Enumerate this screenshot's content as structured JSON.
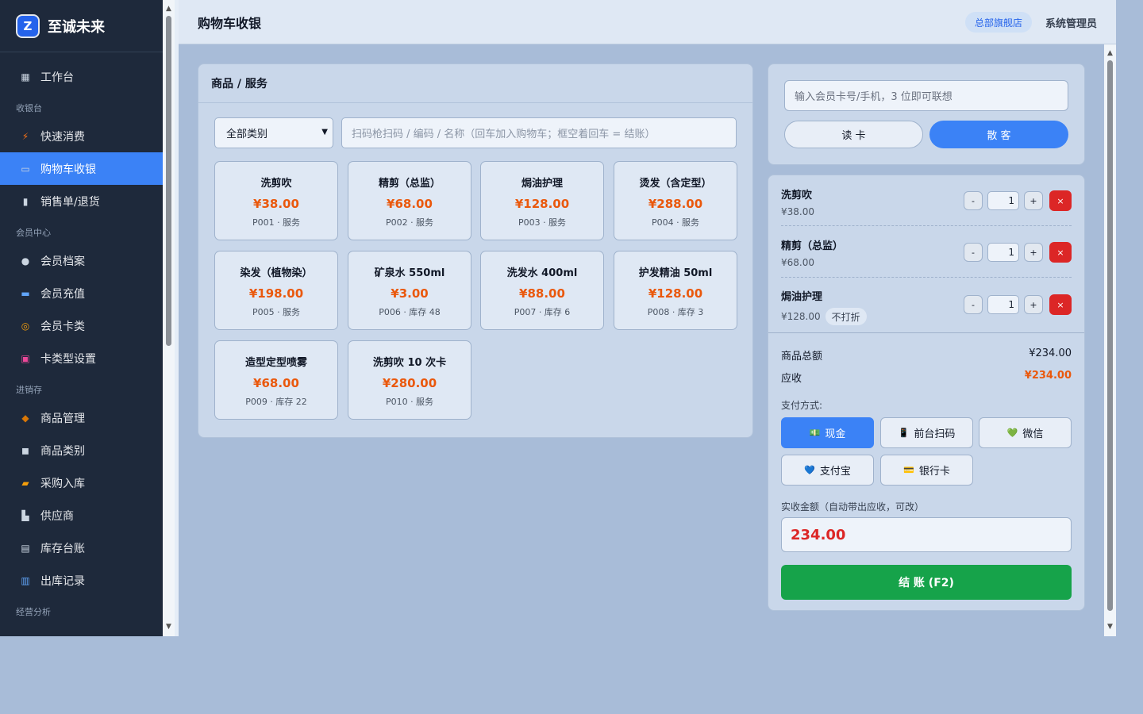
{
  "brand": {
    "logo_text": "Z",
    "name": "至诚未来"
  },
  "sidebar": {
    "items": [
      {
        "icon": "▦",
        "label": "工作台"
      },
      {
        "group": "收银台"
      },
      {
        "icon": "⚡",
        "label": "快速消费"
      },
      {
        "icon": "▭",
        "label": "购物车收银",
        "active": true
      },
      {
        "icon": "▮",
        "label": "销售单/退货"
      },
      {
        "group": "会员中心"
      },
      {
        "icon": "●",
        "label": "会员档案"
      },
      {
        "icon": "▬",
        "label": "会员充值"
      },
      {
        "icon": "◎",
        "label": "会员卡类"
      },
      {
        "icon": "▣",
        "label": "卡类型设置"
      },
      {
        "group": "进销存"
      },
      {
        "icon": "◆",
        "label": "商品管理"
      },
      {
        "icon": "◼",
        "label": "商品类别"
      },
      {
        "icon": "▰",
        "label": "采购入库"
      },
      {
        "icon": "▙",
        "label": "供应商"
      },
      {
        "icon": "▤",
        "label": "库存台账"
      },
      {
        "icon": "▥",
        "label": "出库记录"
      },
      {
        "group": "经营分析"
      }
    ]
  },
  "header": {
    "title": "购物车收银",
    "store": "总部旗舰店",
    "user": "系统管理员"
  },
  "products": {
    "title": "商品 / 服务",
    "category_selected": "全部类别",
    "search_placeholder": "扫码枪扫码 / 编码 / 名称（回车加入购物车；框空着回车 = 结账）",
    "items": [
      {
        "name": "洗剪吹",
        "price": "¥38.00",
        "meta": "P001 · 服务"
      },
      {
        "name": "精剪（总监）",
        "price": "¥68.00",
        "meta": "P002 · 服务"
      },
      {
        "name": "焗油护理",
        "price": "¥128.00",
        "meta": "P003 · 服务"
      },
      {
        "name": "烫发（含定型）",
        "price": "¥288.00",
        "meta": "P004 · 服务"
      },
      {
        "name": "染发（植物染）",
        "price": "¥198.00",
        "meta": "P005 · 服务"
      },
      {
        "name": "矿泉水 550ml",
        "price": "¥3.00",
        "meta": "P006 · 库存 48"
      },
      {
        "name": "洗发水 400ml",
        "price": "¥88.00",
        "meta": "P007 · 库存 6"
      },
      {
        "name": "护发精油 50ml",
        "price": "¥128.00",
        "meta": "P008 · 库存 3"
      },
      {
        "name": "造型定型喷雾",
        "price": "¥68.00",
        "meta": "P009 · 库存 22"
      },
      {
        "name": "洗剪吹 10 次卡",
        "price": "¥280.00",
        "meta": "P010 · 服务"
      }
    ]
  },
  "member": {
    "placeholder": "输入会员卡号/手机，3 位即可联想",
    "read_card": "读 卡",
    "walk_in": "散 客"
  },
  "cart": {
    "items": [
      {
        "name": "洗剪吹",
        "price": "¥38.00",
        "qty": "1",
        "tag": ""
      },
      {
        "name": "精剪（总监）",
        "price": "¥68.00",
        "qty": "1",
        "tag": ""
      },
      {
        "name": "焗油护理",
        "price": "¥128.00",
        "qty": "1",
        "tag": "不打折"
      }
    ],
    "minus": "-",
    "plus": "+",
    "remove": "×",
    "subtotal_label": "商品总额",
    "subtotal": "¥234.00",
    "due_label": "应收",
    "due": "¥234.00",
    "pay_label": "支付方式:",
    "pay_methods": [
      {
        "icon": "💵",
        "label": "现金",
        "selected": true
      },
      {
        "icon": "📱",
        "label": "前台扫码"
      },
      {
        "icon": "💚",
        "label": "微信"
      },
      {
        "icon": "💙",
        "label": "支付宝"
      },
      {
        "icon": "💳",
        "label": "银行卡"
      }
    ],
    "received_label": "实收金额（自动带出应收，可改）",
    "received": "234.00",
    "checkout": "结 账 (F2)"
  },
  "colors": {
    "sidebar": "#1e293b",
    "accent": "#3b82f6",
    "price": "#ea580c",
    "checkout": "#16a34a",
    "danger": "#dc2626"
  }
}
